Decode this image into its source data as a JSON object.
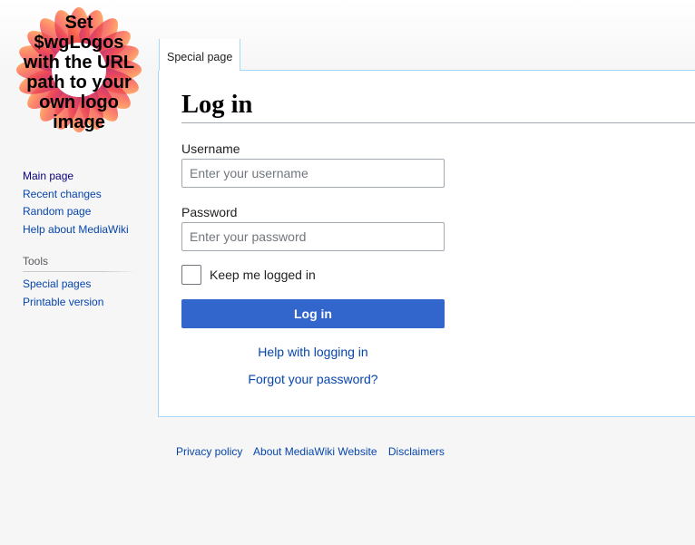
{
  "logo": {
    "lines": [
      "Set",
      "$wgLogos",
      "with the URL",
      "path to your",
      "own logo",
      "image"
    ]
  },
  "sidebar": {
    "navigation": [
      {
        "label": "Main page"
      },
      {
        "label": "Recent changes"
      },
      {
        "label": "Random page"
      },
      {
        "label": "Help about MediaWiki"
      }
    ],
    "tools_heading": "Tools",
    "tools": [
      {
        "label": "Special pages"
      },
      {
        "label": "Printable version"
      }
    ]
  },
  "tabs": {
    "special_page": "Special page"
  },
  "login": {
    "title": "Log in",
    "username_label": "Username",
    "username_placeholder": "Enter your username",
    "username_value": "",
    "password_label": "Password",
    "password_placeholder": "Enter your password",
    "password_value": "",
    "remember_label": "Keep me logged in",
    "remember_checked": false,
    "submit_label": "Log in",
    "help_link": "Help with logging in",
    "forgot_link": "Forgot your password?"
  },
  "footer": {
    "links": [
      "Privacy policy",
      "About MediaWiki Website",
      "Disclaimers"
    ]
  },
  "colors": {
    "link": "#0645ad",
    "button": "#3366cc",
    "border_accent": "#a7d7f9"
  }
}
